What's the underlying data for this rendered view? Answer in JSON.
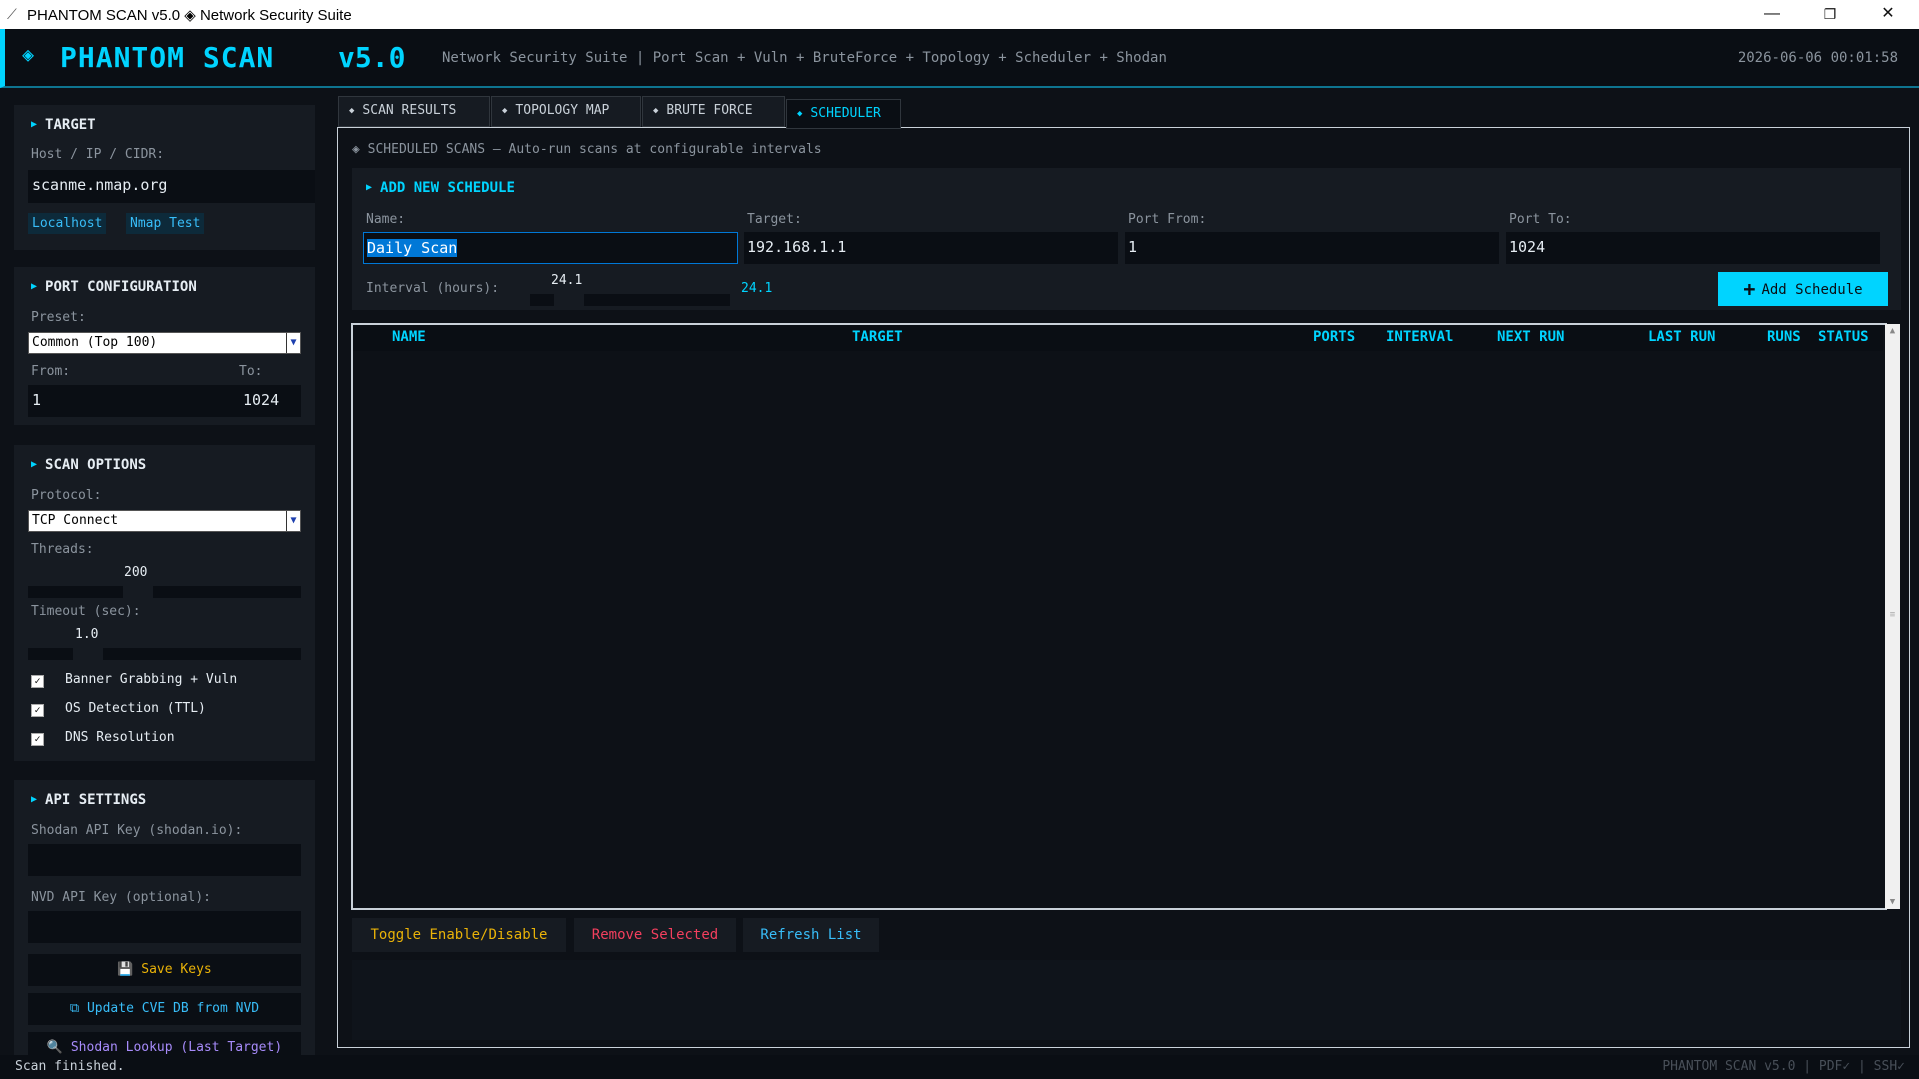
{
  "window": {
    "title": "PHANTOM SCAN v5.0  ◈  Network Security Suite",
    "minimize": "—",
    "restore": "❐",
    "close": "✕"
  },
  "header": {
    "diamond": "◈",
    "logo": "PHANTOM SCAN",
    "version": "v5.0",
    "subtitle": "Network Security Suite | Port Scan + Vuln + BruteForce + Topology + Scheduler + Shodan",
    "date": "2026-06-06",
    "time": "00:01:58"
  },
  "sidebar": {
    "target": {
      "title": "TARGET",
      "host_label": "Host / IP / CIDR:",
      "host_value": "scanme.nmap.org",
      "quick_localhost": "Localhost",
      "quick_nmap": "Nmap Test"
    },
    "ports": {
      "title": "PORT CONFIGURATION",
      "preset_label": "Preset:",
      "preset_value": "Common (Top 100)",
      "from_label": "From:",
      "from_value": "1",
      "to_label": "To:",
      "to_value": "1024"
    },
    "options": {
      "title": "SCAN OPTIONS",
      "protocol_label": "Protocol:",
      "protocol_value": "TCP Connect",
      "threads_label": "Threads:",
      "threads_value": "200",
      "timeout_label": "Timeout (sec):",
      "timeout_value": "1.0",
      "check_banner": "Banner Grabbing + Vuln",
      "check_os": "OS Detection (TTL)",
      "check_dns": "DNS Resolution",
      "check_mark": "✓"
    },
    "api": {
      "title": "API SETTINGS",
      "shodan_label": "Shodan API Key (shodan.io):",
      "shodan_value": "",
      "nvd_label": "NVD API Key (optional):",
      "nvd_value": "",
      "save_keys": "💾  Save Keys",
      "update_cve": "⧉  Update CVE DB from NVD",
      "shodan_lookup": "🔍  Shodan Lookup (Last Target)"
    }
  },
  "tabs": [
    {
      "label": "SCAN RESULTS"
    },
    {
      "label": "TOPOLOGY MAP"
    },
    {
      "label": "BRUTE FORCE"
    },
    {
      "label": "SCHEDULER"
    }
  ],
  "tab_diamond": "◆",
  "scheduler": {
    "info": "◈  SCHEDULED SCANS — Auto-run scans at configurable intervals",
    "add_title": "ADD NEW SCHEDULE",
    "name_label": "Name:",
    "name_value": "Daily Scan",
    "target_label": "Target:",
    "target_value": "192.168.1.1",
    "port_from_label": "Port From:",
    "port_from_value": "1",
    "port_to_label": "Port To:",
    "port_to_value": "1024",
    "interval_label": "Interval (hours):",
    "interval_slider_value": "24.1",
    "interval_display": "24.1",
    "add_button": "Add Schedule",
    "add_plus": "+",
    "columns": [
      "NAME",
      "TARGET",
      "PORTS",
      "INTERVAl",
      "NEXT RUN",
      "LAST RUN",
      "RUNS",
      "STATUS"
    ],
    "rows": [],
    "toggle_button": "Toggle Enable/Disable",
    "remove_button": "Remove Selected",
    "refresh_button": "Refresh List"
  },
  "statusbar": {
    "message": "Scan finished.",
    "right": "PHANTOM SCAN v5.0  |  PDF✓  |  SSH✓"
  },
  "colors": {
    "accent": "#00d4ff",
    "background": "#0d1117",
    "panel": "#161b22",
    "warning": "#eab308",
    "danger": "#f43f5e",
    "link": "#38bdf8"
  }
}
